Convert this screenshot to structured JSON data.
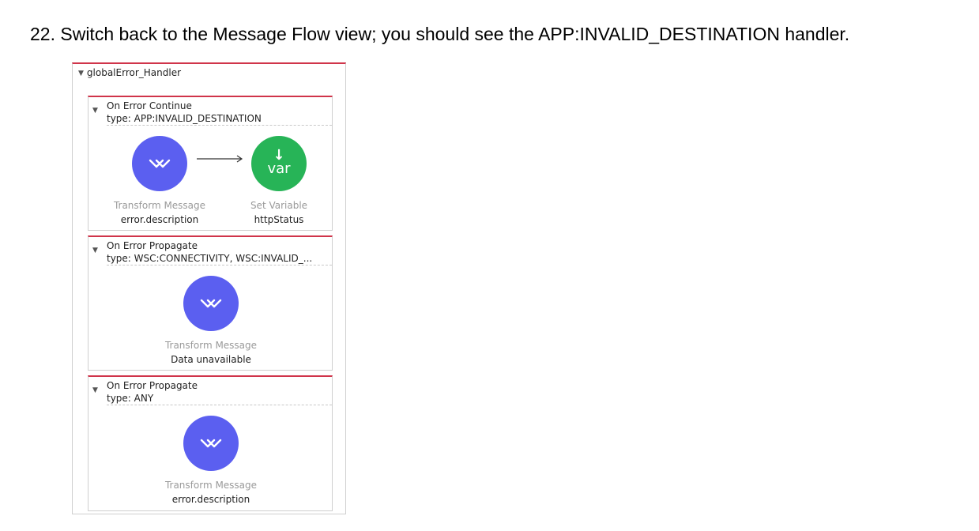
{
  "instruction": "22. Switch back to the Message Flow view; you should see the APP:INVALID_DESTINATION handler.",
  "handler": {
    "title": "globalError_Handler",
    "scopes": [
      {
        "name": "On Error Continue",
        "type": "type: APP:INVALID_DESTINATION",
        "components": [
          {
            "kind": "Transform Message",
            "value": "error.description",
            "icon": "transform-message-icon"
          },
          {
            "kind": "Set Variable",
            "value": "httpStatus",
            "icon": "set-variable-icon",
            "icon_text": "var"
          }
        ]
      },
      {
        "name": "On Error Propagate",
        "type": "type: WSC:CONNECTIVITY, WSC:INVALID_...",
        "components": [
          {
            "kind": "Transform Message",
            "value": "Data unavailable",
            "icon": "transform-message-icon"
          }
        ]
      },
      {
        "name": "On Error Propagate",
        "type": "type: ANY",
        "components": [
          {
            "kind": "Transform Message",
            "value": "error.description",
            "icon": "transform-message-icon"
          }
        ]
      }
    ]
  },
  "colors": {
    "scope_border_top": "#d0344a",
    "transform_icon": "#5b5ff0",
    "set_variable_icon": "#27b457"
  }
}
